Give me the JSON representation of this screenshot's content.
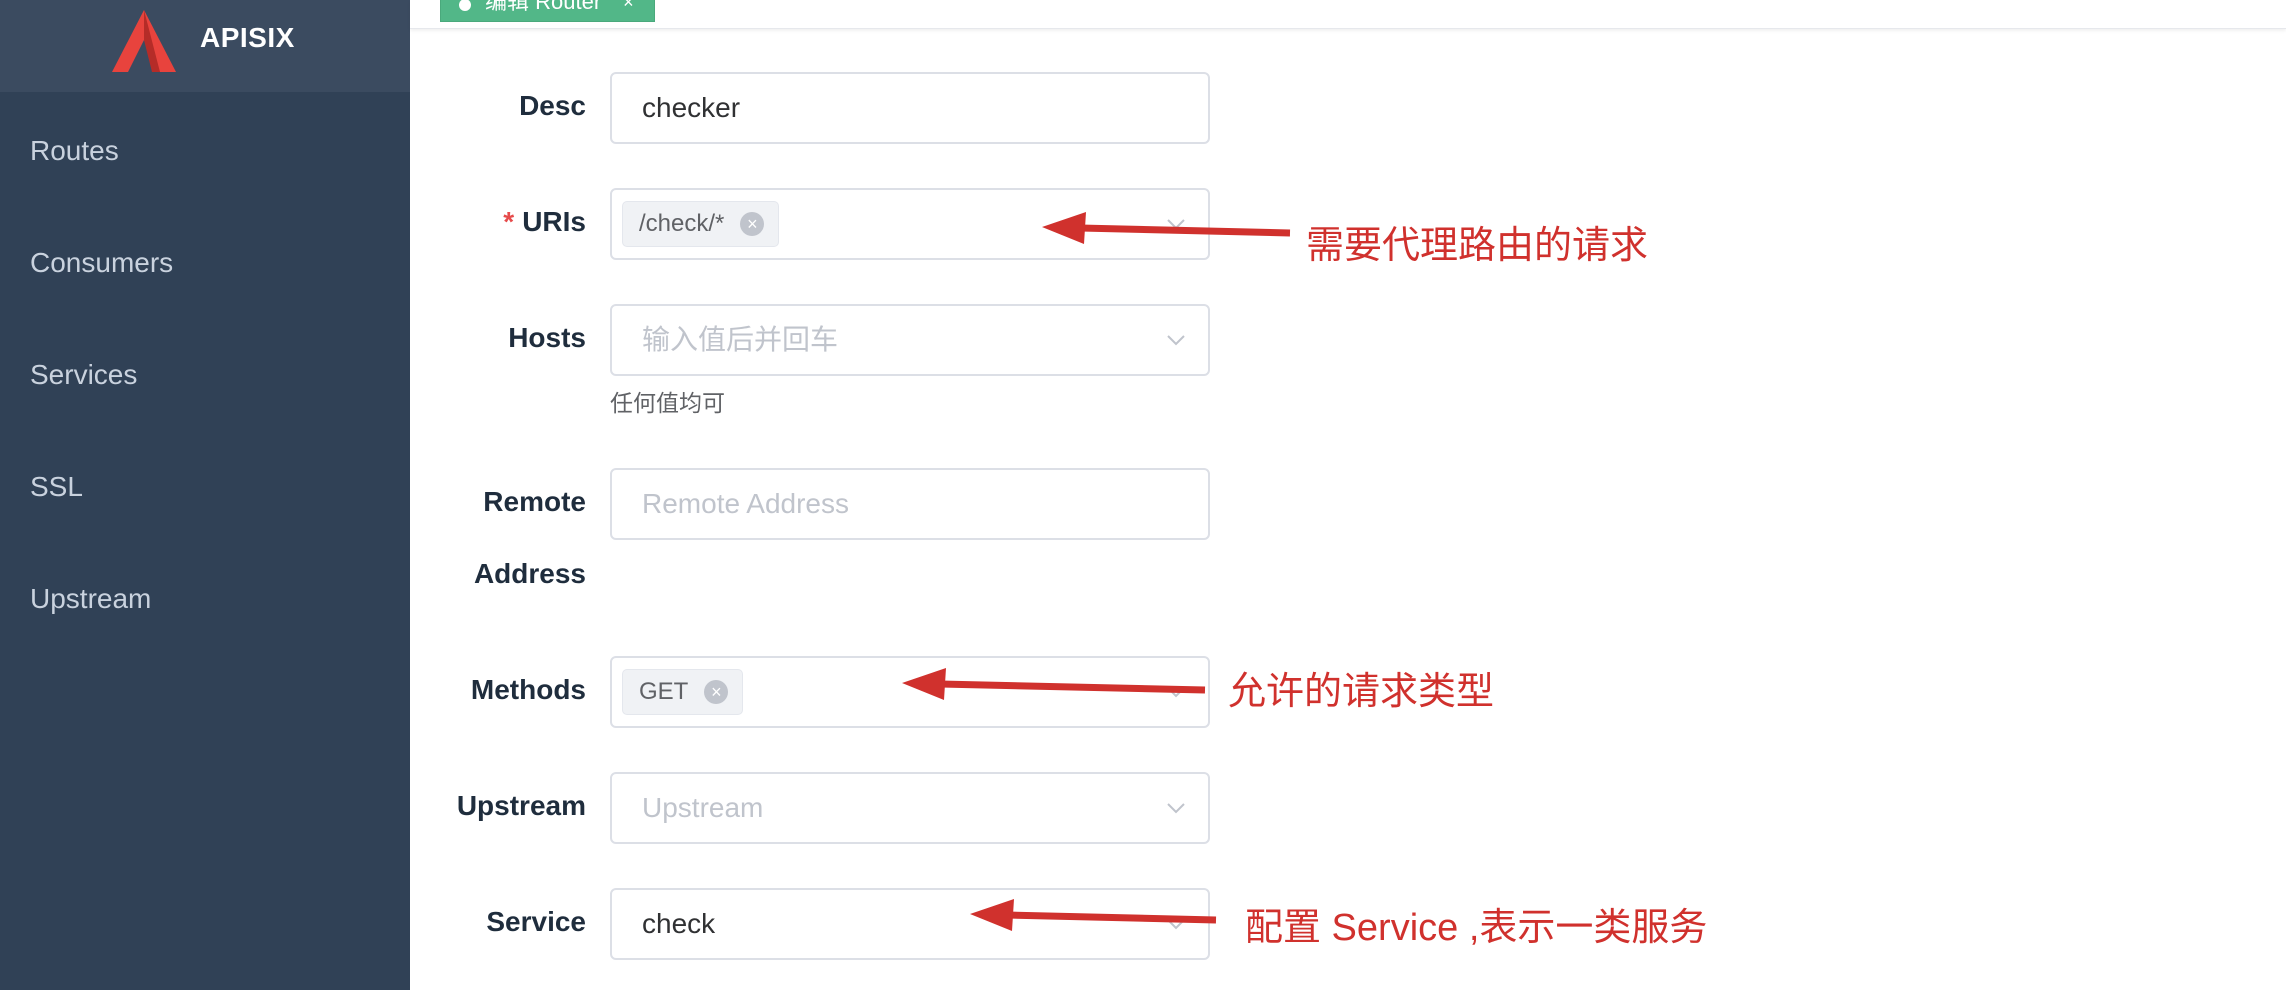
{
  "brand": {
    "name": "APISIX"
  },
  "sidebar": {
    "items": [
      {
        "label": "Routes"
      },
      {
        "label": "Consumers"
      },
      {
        "label": "Services"
      },
      {
        "label": "SSL"
      },
      {
        "label": "Upstream"
      }
    ]
  },
  "tabs": {
    "active": {
      "label": "编辑 Router",
      "close": "×"
    }
  },
  "form": {
    "desc": {
      "label": "Desc",
      "value": "checker"
    },
    "uris": {
      "required_mark": "*",
      "label": "URIs",
      "tag": "/check/*"
    },
    "hosts": {
      "label": "Hosts",
      "placeholder": "输入值后并回车",
      "hint": "任何值均可"
    },
    "remote_address": {
      "label_line1": "Remote",
      "label_line2": "Address",
      "placeholder": "Remote Address"
    },
    "methods": {
      "label": "Methods",
      "tag": "GET"
    },
    "upstream": {
      "label": "Upstream",
      "placeholder": "Upstream"
    },
    "service": {
      "label": "Service",
      "value": "check"
    }
  },
  "annotations": {
    "uris_note": "需要代理路由的请求",
    "methods_note": "允许的请求类型",
    "service_note": "配置 Service ,表示一类服务"
  },
  "colors": {
    "sidebar_bg": "#304156",
    "active_tag": "#52b788",
    "annotation": "#d0312d"
  }
}
